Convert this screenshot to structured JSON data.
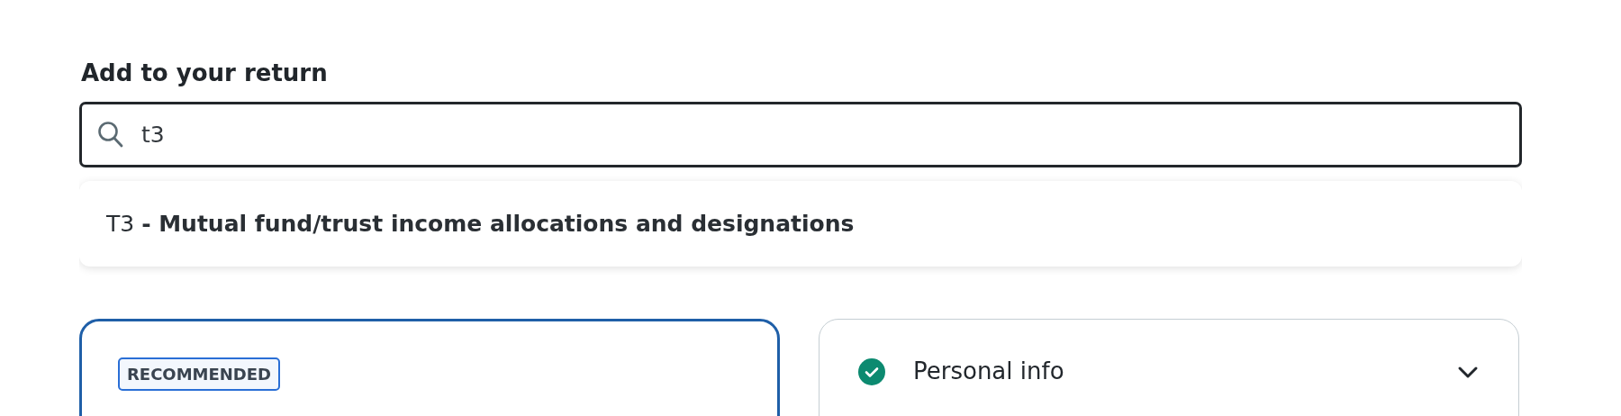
{
  "heading": "Add to your return",
  "search": {
    "value": "t3"
  },
  "suggestions": [
    {
      "text": "T3 **- Mutual fund/trust income allocations and designations**"
    }
  ],
  "recommended_card": {
    "badge": "RECOMMENDED"
  },
  "sections": [
    {
      "label": "Personal info",
      "completed": true,
      "expanded": false
    }
  ]
}
